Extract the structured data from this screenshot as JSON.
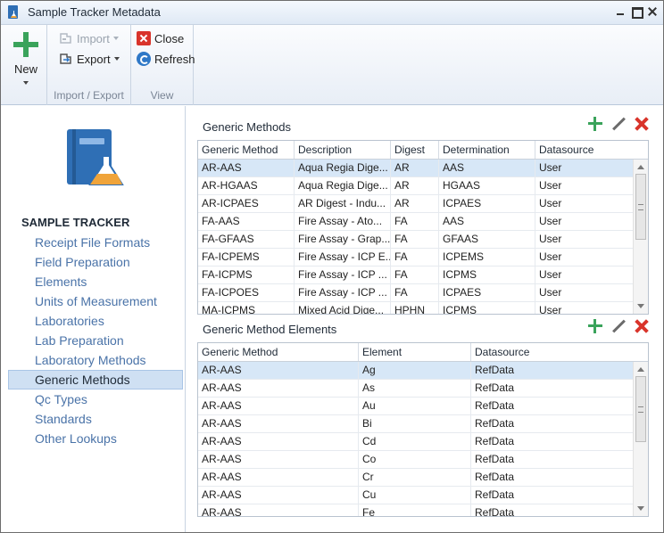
{
  "window": {
    "title": "Sample Tracker Metadata"
  },
  "ribbon": {
    "new_label": "New",
    "import_label": "Import",
    "export_label": "Export",
    "group_import_export": "Import / Export",
    "close_label": "Close",
    "refresh_label": "Refresh",
    "group_view": "View"
  },
  "nav": {
    "heading": "SAMPLE TRACKER",
    "items": [
      {
        "label": "Receipt File Formats"
      },
      {
        "label": "Field Preparation"
      },
      {
        "label": "Elements"
      },
      {
        "label": "Units of Measurement"
      },
      {
        "label": "Laboratories"
      },
      {
        "label": "Lab Preparation"
      },
      {
        "label": "Laboratory Methods"
      },
      {
        "label": "Generic Methods",
        "selected": true
      },
      {
        "label": "Qc Types"
      },
      {
        "label": "Standards"
      },
      {
        "label": "Other Lookups"
      }
    ]
  },
  "methods": {
    "title": "Generic Methods",
    "columns": [
      "Generic Method",
      "Description",
      "Digest",
      "Determination",
      "Datasource"
    ],
    "rows": [
      [
        "AR-AAS",
        "Aqua Regia Dige...",
        "AR",
        "AAS",
        "User"
      ],
      [
        "AR-HGAAS",
        "Aqua Regia Dige...",
        "AR",
        "HGAAS",
        "User"
      ],
      [
        "AR-ICPAES",
        "AR Digest - Indu...",
        "AR",
        "ICPAES",
        "User"
      ],
      [
        "FA-AAS",
        "Fire Assay - Ato...",
        "FA",
        "AAS",
        "User"
      ],
      [
        "FA-GFAAS",
        "Fire Assay - Grap...",
        "FA",
        "GFAAS",
        "User"
      ],
      [
        "FA-ICPEMS",
        "Fire Assay - ICP E...",
        "FA",
        "ICPEMS",
        "User"
      ],
      [
        "FA-ICPMS",
        "Fire Assay - ICP ...",
        "FA",
        "ICPMS",
        "User"
      ],
      [
        "FA-ICPOES",
        "Fire Assay - ICP ...",
        "FA",
        "ICPAES",
        "User"
      ],
      [
        "MA-ICPMS",
        "Mixed Acid Dige...",
        "HPHN",
        "ICPMS",
        "User"
      ]
    ]
  },
  "elements": {
    "title": "Generic Method Elements",
    "columns": [
      "Generic Method",
      "Element",
      "Datasource"
    ],
    "rows": [
      [
        "AR-AAS",
        "Ag",
        "RefData"
      ],
      [
        "AR-AAS",
        "As",
        "RefData"
      ],
      [
        "AR-AAS",
        "Au",
        "RefData"
      ],
      [
        "AR-AAS",
        "Bi",
        "RefData"
      ],
      [
        "AR-AAS",
        "Cd",
        "RefData"
      ],
      [
        "AR-AAS",
        "Co",
        "RefData"
      ],
      [
        "AR-AAS",
        "Cr",
        "RefData"
      ],
      [
        "AR-AAS",
        "Cu",
        "RefData"
      ],
      [
        "AR-AAS",
        "Fe",
        "RefData"
      ]
    ]
  }
}
